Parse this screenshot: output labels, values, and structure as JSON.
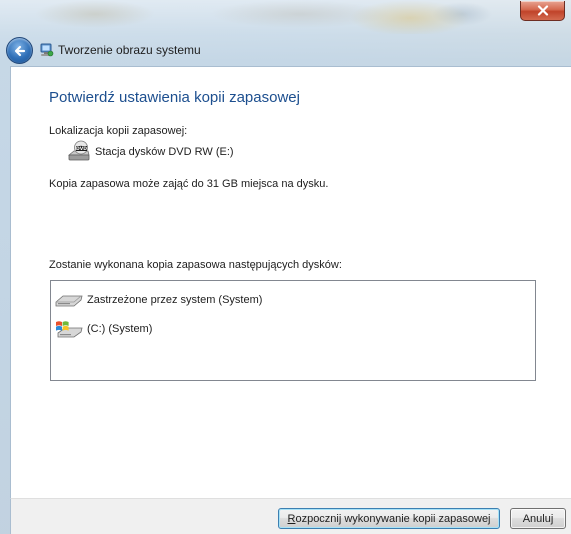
{
  "window": {
    "title": "Tworzenie obrazu systemu"
  },
  "page": {
    "heading": "Potwierdź ustawienia kopii zapasowej",
    "location_label": "Lokalizacja kopii zapasowej:",
    "location_drive": "Stacja dysków DVD RW (E:)",
    "space_note": "Kopia zapasowa może zająć do 31 GB miejsca na dysku.",
    "disks_label": "Zostanie wykonana kopia zapasowa następujących dysków:",
    "disks": [
      {
        "label": "Zastrzeżone przez system (System)",
        "icon": "hard-drive-icon"
      },
      {
        "label": "(C:) (System)",
        "icon": "windows-drive-icon"
      }
    ]
  },
  "footer": {
    "start_button": {
      "accesskey": "R",
      "rest": "ozpocznij wykonywanie kopii zapasowej"
    },
    "cancel_button": "Anuluj"
  },
  "colors": {
    "heading": "#1d4f8f",
    "close_button": "#c0432a",
    "back_button": "#2f6fb7"
  }
}
